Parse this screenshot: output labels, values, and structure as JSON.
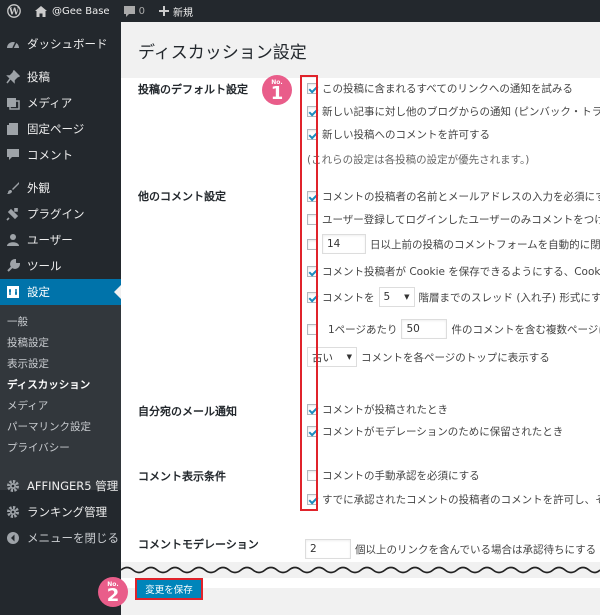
{
  "adminbar": {
    "site_name": "@Gee Base",
    "comments_count": "0",
    "new_label": "新規"
  },
  "sidebar": {
    "items": [
      {
        "label": "ダッシュボード",
        "icon": "dashboard-icon"
      },
      {
        "label": "投稿",
        "icon": "pushpin-icon"
      },
      {
        "label": "メディア",
        "icon": "media-icon"
      },
      {
        "label": "固定ページ",
        "icon": "page-icon"
      },
      {
        "label": "コメント",
        "icon": "comment-icon"
      },
      {
        "label": "外観",
        "icon": "brush-icon"
      },
      {
        "label": "プラグイン",
        "icon": "plugin-icon"
      },
      {
        "label": "ユーザー",
        "icon": "user-icon"
      },
      {
        "label": "ツール",
        "icon": "wrench-icon"
      },
      {
        "label": "設定",
        "icon": "settings-icon"
      }
    ],
    "submenu": [
      "一般",
      "投稿設定",
      "表示設定",
      "ディスカッション",
      "メディア",
      "パーマリンク設定",
      "プライバシー"
    ],
    "bottom_items": [
      {
        "label": "AFFINGER5 管理",
        "icon": "gear-icon"
      },
      {
        "label": "ランキング管理",
        "icon": "gear-icon"
      },
      {
        "label": "メニューを閉じる",
        "icon": "collapse-icon"
      }
    ]
  },
  "page": {
    "title": "ディスカッション設定"
  },
  "sections": {
    "default_post": {
      "label": "投稿のデフォルト設定",
      "options": [
        {
          "text": "この投稿に含まれるすべてのリンクへの通知を試みる",
          "checked": true
        },
        {
          "text": "新しい記事に対し他のブログからの通知 (ピンバック・トラックバック) を受け付ける",
          "checked": true
        },
        {
          "text": "新しい投稿へのコメントを許可する",
          "checked": true
        }
      ],
      "note": "(これらの設定は各投稿の設定が優先されます。)"
    },
    "other_comment": {
      "label": "他のコメント設定",
      "opt1": "コメントの投稿者の名前とメールアドレスの入力を必須にする",
      "opt2": "ユーザー登録してログインしたユーザーのみコメントをつけられるようにする",
      "opt3_value": "14",
      "opt3_text": "日以上前の投稿のコメントフォームを自動的に閉じる",
      "opt4": "コメント投稿者が Cookie を保存できるようにする、Cookie オプトイン用チェックボックスを表示します。",
      "opt5_prefix": "コメントを",
      "opt5_select": "5",
      "opt5_suffix": "階層までのスレッド (入れ子) 形式にする",
      "opt6_prefix": "1ページあたり",
      "opt6_value": "50",
      "opt6_suffix": "件のコメントを含む複数ページに分割し、",
      "opt7_select": "古い",
      "opt7_suffix": "コメントを各ページのトップに表示する"
    },
    "email_me": {
      "label": "自分宛のメール通知",
      "opt1": "コメントが投稿されたとき",
      "opt2": "コメントがモデレーションのために保留されたとき"
    },
    "before_appear": {
      "label": "コメント表示条件",
      "opt1": "コメントの手動承認を必須にする",
      "opt2": "すでに承認されたコメントの投稿者のコメントを許可し、それ以外のコメントを承認待ちにする"
    },
    "moderation": {
      "label": "コメントモデレーション",
      "value": "2",
      "text": "個以上のリンクを含んでいる場合は承認待ちにする"
    }
  },
  "badges": {
    "no_label": "No.",
    "first": "1",
    "second": "2"
  },
  "save_button": "変更を保存",
  "colors": {
    "admin_dark": "#23282d",
    "active_blue": "#0073aa",
    "highlight_red": "#e0232b",
    "badge_pink": "#e95d8a",
    "button_blue": "#0085ba"
  }
}
